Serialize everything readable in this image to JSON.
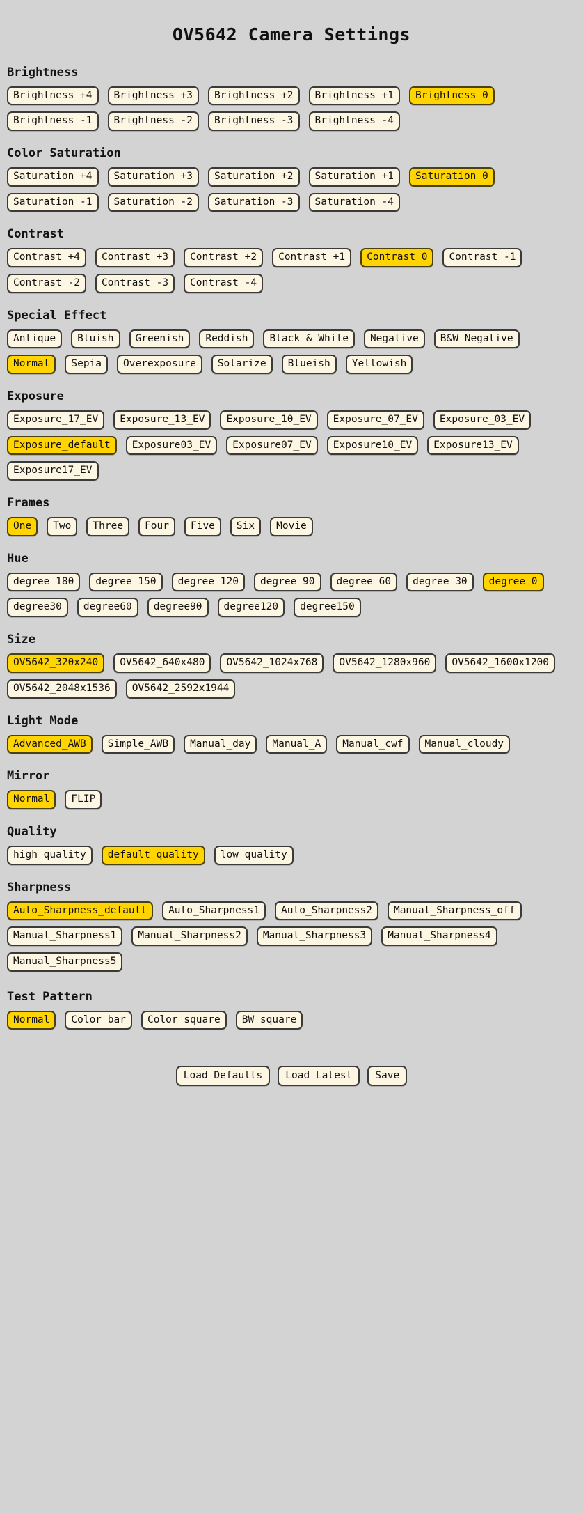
{
  "page": {
    "title": "OV5642 Camera Settings",
    "background_color": "#d3d3d3",
    "button_color": "#fdf6e3",
    "selected_color": "#ffd400",
    "border_color": "#3a3a38",
    "text_color": "#111111"
  },
  "sections": [
    {
      "id": "brightness",
      "heading": "Brightness",
      "selected": "Brightness 0",
      "options": [
        "Brightness +4",
        "Brightness +3",
        "Brightness +2",
        "Brightness +1",
        "Brightness 0",
        "Brightness -1",
        "Brightness -2",
        "Brightness -3",
        "Brightness -4"
      ]
    },
    {
      "id": "color_saturation",
      "heading": "Color Saturation",
      "selected": "Saturation 0",
      "options": [
        "Saturation +4",
        "Saturation +3",
        "Saturation +2",
        "Saturation +1",
        "Saturation 0",
        "Saturation -1",
        "Saturation -2",
        "Saturation -3",
        "Saturation -4"
      ]
    },
    {
      "id": "contrast",
      "heading": "Contrast",
      "selected": "Contrast 0",
      "options": [
        "Contrast +4",
        "Contrast +3",
        "Contrast +2",
        "Contrast +1",
        "Contrast 0",
        "Contrast -1",
        "Contrast -2",
        "Contrast -3",
        "Contrast -4"
      ]
    },
    {
      "id": "special_effect",
      "heading": "Special Effect",
      "selected": "Normal",
      "options": [
        "Antique",
        "Bluish",
        "Greenish",
        "Reddish",
        "Black & White",
        "Negative",
        "B&W Negative",
        "Normal",
        "Sepia",
        "Overexposure",
        "Solarize",
        "Blueish",
        "Yellowish"
      ]
    },
    {
      "id": "exposure",
      "heading": "Exposure",
      "selected": "Exposure_default",
      "options": [
        "Exposure_17_EV",
        "Exposure_13_EV",
        "Exposure_10_EV",
        "Exposure_07_EV",
        "Exposure_03_EV",
        "Exposure_default",
        "Exposure03_EV",
        "Exposure07_EV",
        "Exposure10_EV",
        "Exposure13_EV",
        "Exposure17_EV"
      ]
    },
    {
      "id": "frames",
      "heading": "Frames",
      "selected": "One",
      "options": [
        "One",
        "Two",
        "Three",
        "Four",
        "Five",
        "Six",
        "Movie"
      ]
    },
    {
      "id": "hue",
      "heading": "Hue",
      "selected": "degree_0",
      "options": [
        "degree_180",
        "degree_150",
        "degree_120",
        "degree_90",
        "degree_60",
        "degree_30",
        "degree_0",
        "degree30",
        "degree60",
        "degree90",
        "degree120",
        "degree150"
      ]
    },
    {
      "id": "size",
      "heading": "Size",
      "selected": "OV5642_320x240",
      "options": [
        "OV5642_320x240",
        "OV5642_640x480",
        "OV5642_1024x768",
        "OV5642_1280x960",
        "OV5642_1600x1200",
        "OV5642_2048x1536",
        "OV5642_2592x1944"
      ]
    },
    {
      "id": "light_mode",
      "heading": "Light Mode",
      "selected": "Advanced_AWB",
      "options": [
        "Advanced_AWB",
        "Simple_AWB",
        "Manual_day",
        "Manual_A",
        "Manual_cwf",
        "Manual_cloudy"
      ]
    },
    {
      "id": "mirror",
      "heading": "Mirror",
      "selected": "Normal",
      "options": [
        "Normal",
        "FLIP"
      ]
    },
    {
      "id": "quality",
      "heading": "Quality",
      "selected": "default_quality",
      "options": [
        "high_quality",
        "default_quality",
        "low_quality"
      ]
    },
    {
      "id": "sharpness",
      "heading": "Sharpness",
      "selected": "Auto_Sharpness_default",
      "options": [
        "Auto_Sharpness_default",
        "Auto_Sharpness1",
        "Auto_Sharpness2",
        "Manual_Sharpness_off",
        "Manual_Sharpness1",
        "Manual_Sharpness2",
        "Manual_Sharpness3",
        "Manual_Sharpness4",
        "Manual_Sharpness5"
      ]
    },
    {
      "id": "test_pattern",
      "heading": "Test Pattern",
      "selected": "Normal",
      "options": [
        "Normal",
        "Color_bar",
        "Color_square",
        "BW_square"
      ]
    }
  ],
  "footer": {
    "actions": [
      "Load Defaults",
      "Load Latest",
      "Save"
    ]
  }
}
